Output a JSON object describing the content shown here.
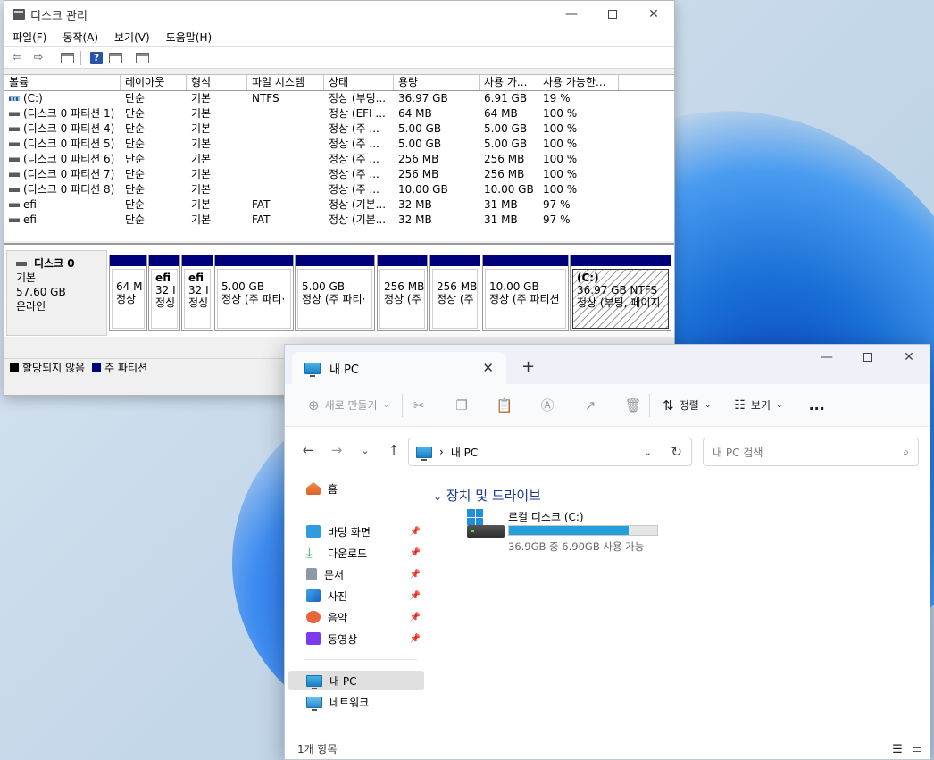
{
  "desktop": {
    "accent": "#1a6fd6"
  },
  "disk_management": {
    "title": "디스크 관리",
    "menu": [
      "파일(F)",
      "동작(A)",
      "보기(V)",
      "도움말(H)"
    ],
    "toolbar_icons": [
      "back-arrow-icon",
      "forward-arrow-icon",
      "properties-icon",
      "help-icon",
      "view-icon",
      "settings-icon"
    ],
    "columns": [
      "볼륨",
      "레이아웃",
      "형식",
      "파일 시스템",
      "상태",
      "용량",
      "사용 가...",
      "사용 가능한..."
    ],
    "volumes": [
      [
        "(C:)",
        "단순",
        "기본",
        "NTFS",
        "정상 (부팅...",
        "36.97 GB",
        "6.91 GB",
        "19 %"
      ],
      [
        "(디스크 0 파티션 1)",
        "단순",
        "기본",
        "",
        "정상 (EFI ...",
        "64 MB",
        "64 MB",
        "100 %"
      ],
      [
        "(디스크 0 파티션 4)",
        "단순",
        "기본",
        "",
        "정상 (주 ...",
        "5.00 GB",
        "5.00 GB",
        "100 %"
      ],
      [
        "(디스크 0 파티션 5)",
        "단순",
        "기본",
        "",
        "정상 (주 ...",
        "5.00 GB",
        "5.00 GB",
        "100 %"
      ],
      [
        "(디스크 0 파티션 6)",
        "단순",
        "기본",
        "",
        "정상 (주 ...",
        "256 MB",
        "256 MB",
        "100 %"
      ],
      [
        "(디스크 0 파티션 7)",
        "단순",
        "기본",
        "",
        "정상 (주 ...",
        "256 MB",
        "256 MB",
        "100 %"
      ],
      [
        "(디스크 0 파티션 8)",
        "단순",
        "기본",
        "",
        "정상 (주 ...",
        "10.00 GB",
        "10.00 GB",
        "100 %"
      ],
      [
        "efi",
        "단순",
        "기본",
        "FAT",
        "정상 (기본...",
        "32 MB",
        "31 MB",
        "97 %"
      ],
      [
        "efi",
        "단순",
        "기본",
        "FAT",
        "정상 (기본...",
        "32 MB",
        "31 MB",
        "97 %"
      ]
    ],
    "disk": {
      "name": "디스크 0",
      "type": "기본",
      "size": "57.60 GB",
      "status": "온라인"
    },
    "partitions": [
      {
        "name": "",
        "line1": "64 M",
        "line2": "정상"
      },
      {
        "name": "efi",
        "line1": "32 I",
        "line2": "정싱"
      },
      {
        "name": "efi",
        "line1": "32 I",
        "line2": "정싱"
      },
      {
        "name": "",
        "line1": "5.00 GB",
        "line2": "정상 (주 파티·"
      },
      {
        "name": "",
        "line1": "5.00 GB",
        "line2": "정상 (주 파티·"
      },
      {
        "name": "",
        "line1": "256 MB",
        "line2": "정상 (주"
      },
      {
        "name": "",
        "line1": "256 MB",
        "line2": "정상 (주"
      },
      {
        "name": "",
        "line1": "10.00 GB",
        "line2": "정상 (주 파티션"
      },
      {
        "name": "(C:)",
        "line1": "36.97 GB NTFS",
        "line2": "정상 (부팅, 페이지"
      }
    ],
    "legend": {
      "unallocated": "할당되지 않음",
      "primary": "주 파티션",
      "unallocated_color": "#000000",
      "primary_color": "#00007b"
    }
  },
  "explorer": {
    "tab_title": "내 PC",
    "commands": {
      "new": "새로 만들기",
      "sort": "정렬",
      "view": "보기",
      "more": "..."
    },
    "address": {
      "location": "내 PC"
    },
    "search_placeholder": "내 PC 검색",
    "nav": {
      "home": "홈",
      "quick": [
        "바탕 화면",
        "다운로드",
        "문서",
        "사진",
        "음악",
        "동영상"
      ],
      "this_pc": "내 PC",
      "network": "네트워크"
    },
    "group_title": "장치 및 드라이브",
    "drive": {
      "name": "로컬 디스크 (C:)",
      "usage_text": "36.9GB 중 6.90GB 사용 가능",
      "used_fraction": 0.81
    },
    "status": "1개 항목"
  }
}
